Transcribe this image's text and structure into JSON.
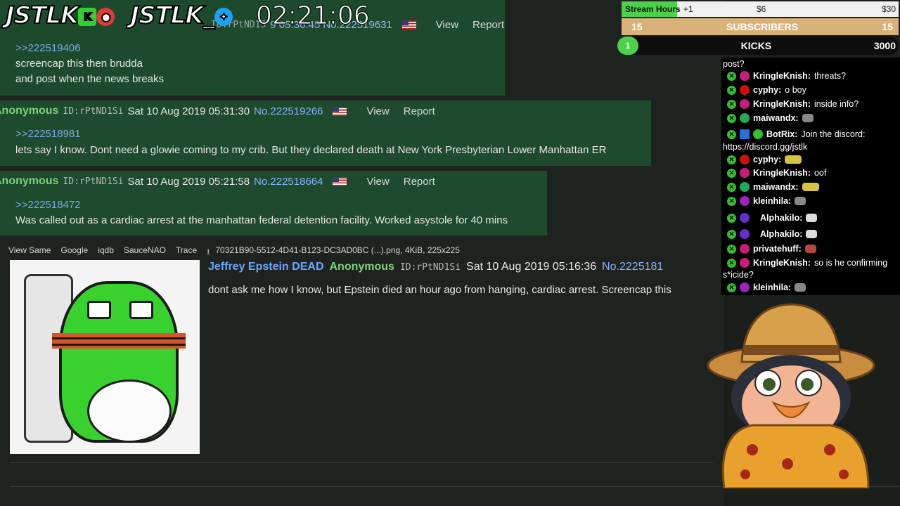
{
  "overlay": {
    "logo1": "JSTLK",
    "logo1_badge": "K",
    "logo2": "JSTLK_",
    "timer": "02:21:06"
  },
  "goals": {
    "stream_hours_label": "Stream Hours",
    "stream_hours_inc": "+1",
    "stream_hours_mid": "$6",
    "stream_hours_max": "$30",
    "subs_left": "15",
    "subs_label": "SUBSCRIBERS",
    "subs_right": "15",
    "kicks_num": "1",
    "kicks_label": "KICKS",
    "kicks_target": "3000"
  },
  "posts": [
    {
      "header_partial": "9 05:36:45 No.222519631",
      "id_partial": "ID:rPtND1S",
      "view": "View",
      "report": "Report",
      "quote": ">>222519406",
      "lines": [
        "screencap this then brudda",
        "and post when the news breaks"
      ]
    },
    {
      "name": "Anonymous",
      "id": "ID:rPtND1Si",
      "date": "Sat 10 Aug 2019 05:31:30",
      "no": "No.222519266",
      "view": "View",
      "report": "Report",
      "quote": ">>222518981",
      "text": "lets say I know. Dont need a glowie coming to my crib. But they declared death at New York Presbyterian Lower Manhattan ER"
    },
    {
      "name": "Anonymous",
      "id": "ID:rPtND1Si",
      "date": "Sat 10 Aug 2019 05:21:58",
      "no": "No.222518664",
      "view": "View",
      "report": "Report",
      "quote": ">>222518472",
      "text": "Was called out as a cardiac arrest at the manhattan federal detention facility. Worked asystole for 40 mins"
    }
  ],
  "op": {
    "tools": [
      "View Same",
      "Google",
      "iqdb",
      "SauceNAO",
      "Trace"
    ],
    "fileinfo": "70321B90-5512-4D41-B123-DC3AD0BC (...).png, 4KiB, 225x225",
    "subject": "Jeffrey Epstein DEAD",
    "name": "Anonymous",
    "id": "ID:rPtND1Si",
    "date": "Sat 10 Aug 2019 05:16:36",
    "no": "No.2225181",
    "text": "dont ask me how I know, but Epstein died an hour ago from hanging, cardiac arrest. Screencap this"
  },
  "chat": {
    "top_fragment": "post?",
    "messages": [
      {
        "user": "KringleKnish:",
        "text": "threats?",
        "color": "#c41e7a"
      },
      {
        "user": "cyphy:",
        "text": "o boy",
        "color": "#cc1111"
      },
      {
        "user": "KringleKnish:",
        "text": "inside info?",
        "color": "#c41e7a"
      },
      {
        "user": "maiwandx:",
        "text": "",
        "color": "#22aa55"
      },
      {
        "user": "BotRix:",
        "text": "Join the discord:",
        "color": "#2d6cdf"
      },
      {
        "user": "cyphy:",
        "text": "",
        "color": "#cc1111"
      },
      {
        "user": "KringleKnish:",
        "text": "oof",
        "color": "#c41e7a"
      },
      {
        "user": "maiwandx:",
        "text": "",
        "color": "#22aa55"
      },
      {
        "user": "kleinhila:",
        "text": "",
        "color": "#a020c0"
      },
      {
        "user": "Alphakilo:",
        "text": "",
        "color": "#6a2ad0"
      },
      {
        "user": "Alphakilo:",
        "text": "",
        "color": "#6a2ad0"
      },
      {
        "user": "privatehuff:",
        "text": "",
        "color": "#c41e7a"
      },
      {
        "user": "KringleKnish:",
        "text": "so is he confirming",
        "color": "#c41e7a"
      },
      {
        "user": "kleinhila:",
        "text": "",
        "color": "#a020c0"
      }
    ],
    "botrix_link": "https://discord.gg/jstlk",
    "wrap_text": "s*icide?"
  }
}
